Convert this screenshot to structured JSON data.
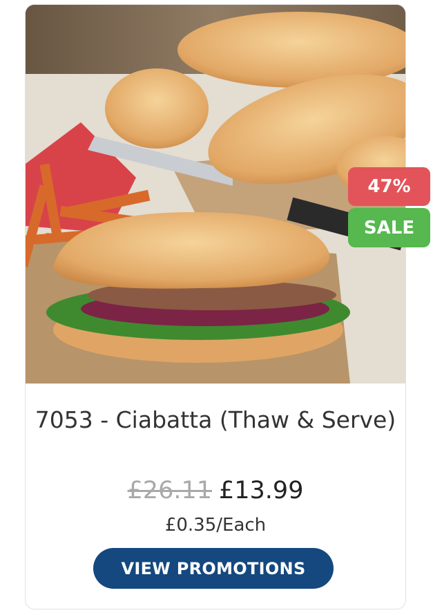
{
  "product": {
    "title": "7053 - Ciabatta (Thaw & Serve)",
    "old_price": "£26.11",
    "price": "£13.99",
    "unit_price": "£0.35/Each",
    "badge_percent": "47%",
    "badge_sale": "SALE",
    "image_subject": "ciabatta-sandwich-photo"
  },
  "actions": {
    "view_promotions": "VIEW PROMOTIONS"
  },
  "colors": {
    "badge_percent": "#e2545a",
    "badge_sale": "#56b84e",
    "button": "#14487f",
    "old_price": "#a9a9a9"
  }
}
